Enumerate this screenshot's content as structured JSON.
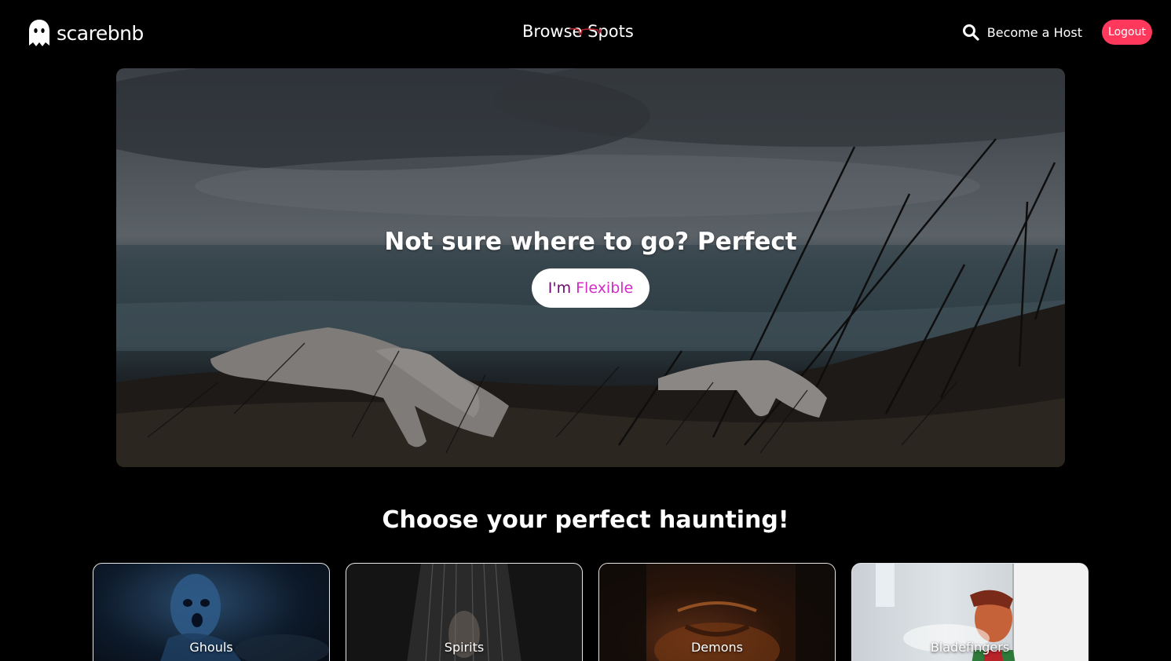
{
  "header": {
    "logo_text": "scarebnb",
    "logo_icon": "ghost-icon",
    "browse_label": "Browse Spots",
    "search_icon": "search-icon",
    "host_label": "Become a Host",
    "logout_label": "Logout",
    "accent_color": "#ff385c"
  },
  "hero": {
    "title": "Not sure where to go? Perfect",
    "button_part1": "I'm ",
    "button_part2": "Flexible",
    "button_colors": [
      "#6b0b6f",
      "#d52ac8"
    ]
  },
  "categories": {
    "title": "Choose your perfect haunting!",
    "items": [
      {
        "label": "Ghouls"
      },
      {
        "label": "Spirits"
      },
      {
        "label": "Demons"
      },
      {
        "label": "Bladefingers"
      }
    ]
  }
}
